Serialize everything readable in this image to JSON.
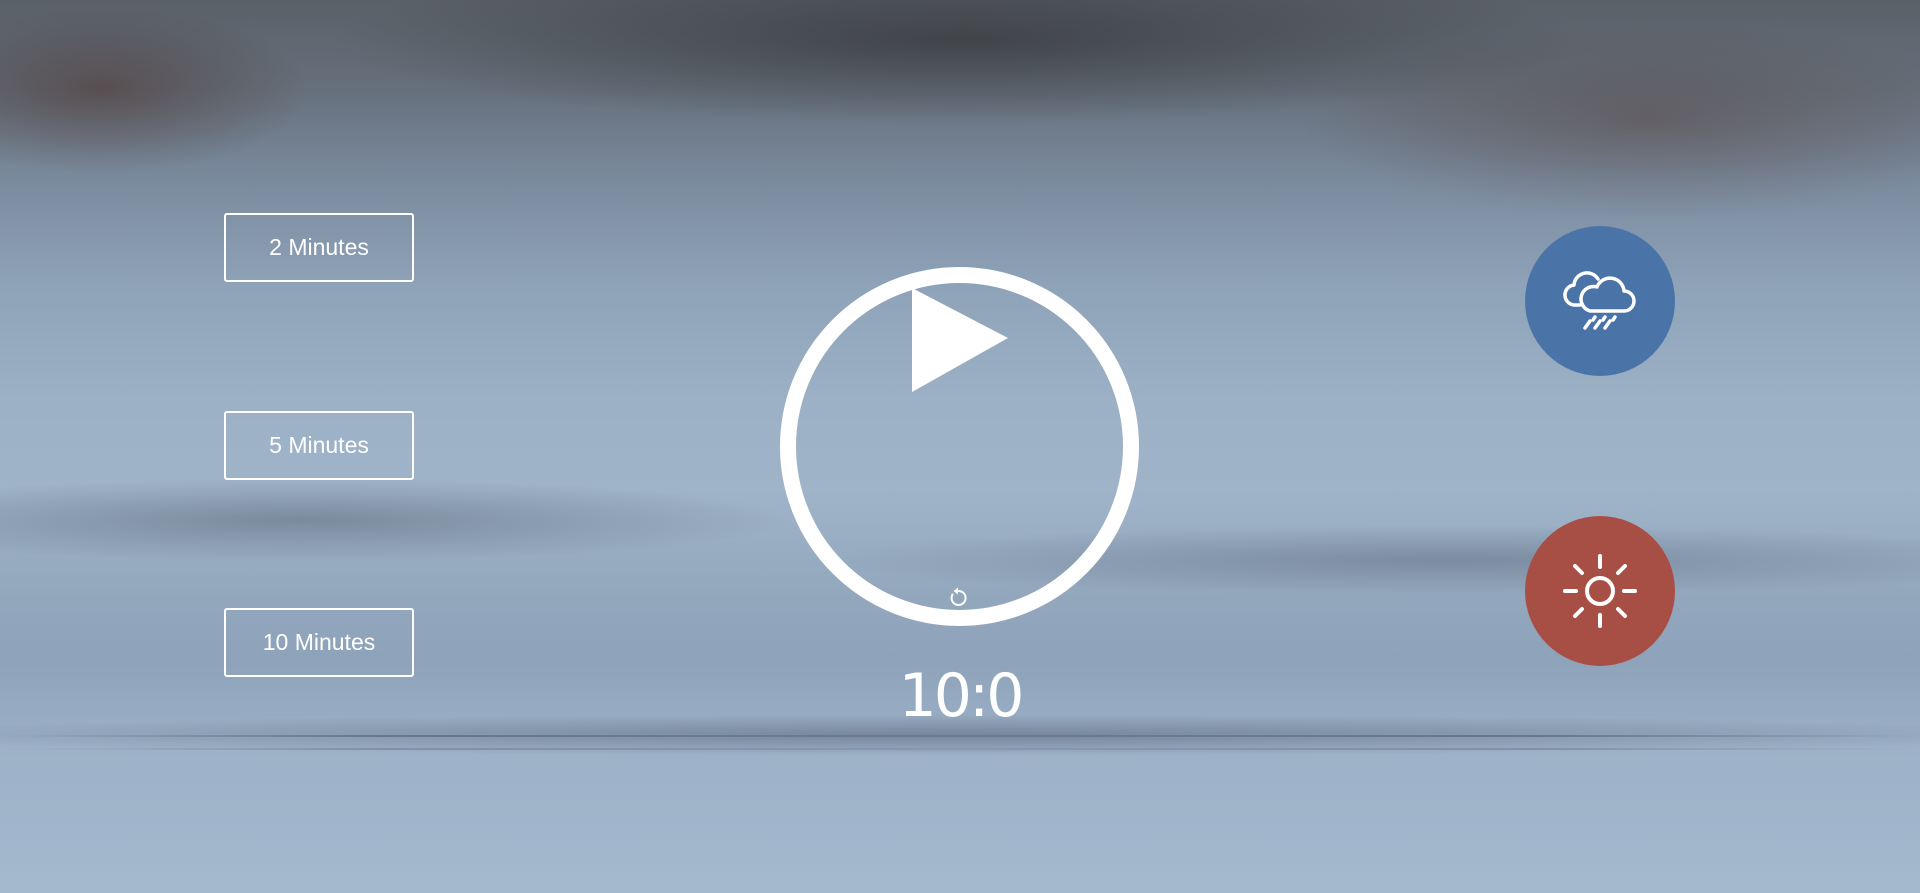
{
  "presets": [
    {
      "label": "2 Minutes"
    },
    {
      "label": "5 Minutes"
    },
    {
      "label": "10 Minutes"
    }
  ],
  "timer": {
    "display": "10:0",
    "play_icon": "play-icon",
    "reset_icon": "reset-icon"
  },
  "sounds": {
    "rain": {
      "icon": "rain-cloud-icon",
      "color": "#4a74a8"
    },
    "summer": {
      "icon": "sun-icon",
      "color": "#a84f45"
    }
  }
}
